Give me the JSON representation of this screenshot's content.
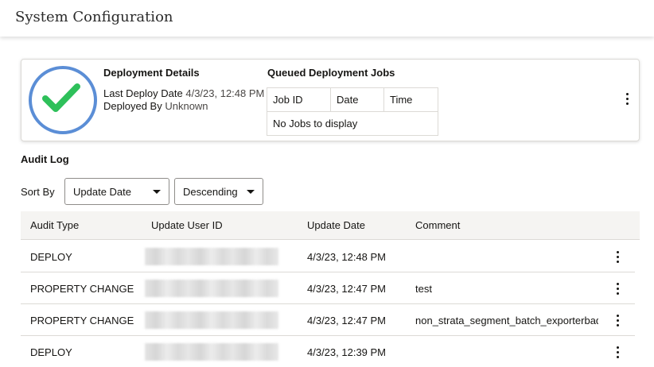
{
  "header": {
    "title": "System Configuration"
  },
  "deployment": {
    "status_icon": "check-circle-icon",
    "heading": "Deployment Details",
    "last_deploy_label": "Last Deploy Date",
    "last_deploy_value": "4/3/23, 12:48 PM",
    "deployed_by_label": "Deployed By",
    "deployed_by_value": "Unknown"
  },
  "queued_jobs": {
    "heading": "Queued Deployment Jobs",
    "columns": [
      "Job ID",
      "Date",
      "Time"
    ],
    "empty_text": "No Jobs to display"
  },
  "audit_log": {
    "heading": "Audit Log",
    "sort_label": "Sort By",
    "sort_field": "Update Date",
    "sort_order": "Descending",
    "columns": [
      "Audit Type",
      "Update User ID",
      "Update Date",
      "Comment"
    ],
    "rows": [
      {
        "type": "DEPLOY",
        "user_id": "",
        "date": "4/3/23, 12:48 PM",
        "comment": ""
      },
      {
        "type": "PROPERTY CHANGE",
        "user_id": "",
        "date": "4/3/23, 12:47 PM",
        "comment": "test"
      },
      {
        "type": "PROPERTY CHANGE",
        "user_id": "",
        "date": "4/3/23, 12:47 PM",
        "comment": "non_strata_segment_batch_exporterbad"
      },
      {
        "type": "DEPLOY",
        "user_id": "",
        "date": "4/3/23, 12:39 PM",
        "comment": ""
      }
    ]
  },
  "colors": {
    "status_ring": "#5b8ed6",
    "success_check": "#2ec05a",
    "header_bg": "#f5f4f2",
    "border": "#dcdad6"
  }
}
